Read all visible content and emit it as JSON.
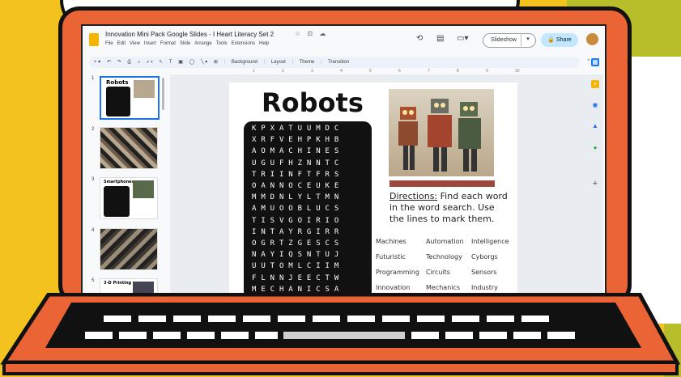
{
  "window": {
    "doc_title": "Innovation Mini Pack Google Slides - I Heart Literacy Set 2",
    "title_icons": "☆ ⊡ ☁",
    "menu": [
      "File",
      "Edit",
      "View",
      "Insert",
      "Format",
      "Slide",
      "Arrange",
      "Tools",
      "Extensions",
      "Help"
    ],
    "slideshow_label": "Slideshow",
    "share_label": "Share"
  },
  "toolbar": {
    "background_label": "Background",
    "layout_label": "Layout",
    "theme_label": "Theme",
    "transition_label": "Transition"
  },
  "ruler": [
    "1",
    "2",
    "3",
    "4",
    "5",
    "6",
    "7",
    "8",
    "9",
    "10"
  ],
  "filmstrip": [
    {
      "num": "1",
      "label": "Robots"
    },
    {
      "num": "2",
      "label": ""
    },
    {
      "num": "3",
      "label": "Smartphones"
    },
    {
      "num": "4",
      "label": ""
    },
    {
      "num": "5",
      "label": "3-D Printing"
    }
  ],
  "slide": {
    "title": "Robots",
    "grid": [
      "KPXATUUMDC",
      "XRFVEHPKHB",
      "AOMACHINES",
      "UGUFHZNNTC",
      "TRIINFTFRS",
      "OANNOCEUKE",
      "MMDNLYLTMN",
      "AMUOOBLUCS",
      "TISVGOIRIO",
      "INTAYRGIRR",
      "OGRTZGESCS",
      "NAYIQSNTUJ",
      "UUTOMLCIIM",
      "FLNNJEECTW",
      "MECHANICSA"
    ],
    "directions_label": "Directions:",
    "directions_text": " Find each word in the word search. Use the lines to mark them.",
    "words": [
      [
        "Machines",
        "Automation",
        "Intelligence"
      ],
      [
        "Futuristic",
        "Technology",
        "Cyborgs"
      ],
      [
        "Programming",
        "Circuits",
        "Sensors"
      ],
      [
        "Innovation",
        "Mechanics",
        "Industry"
      ]
    ]
  },
  "colors": {
    "accent": "#1a73e8",
    "share_bg": "#c2e7ff",
    "laptop": "#ea6436",
    "background": "#f4c21f"
  }
}
